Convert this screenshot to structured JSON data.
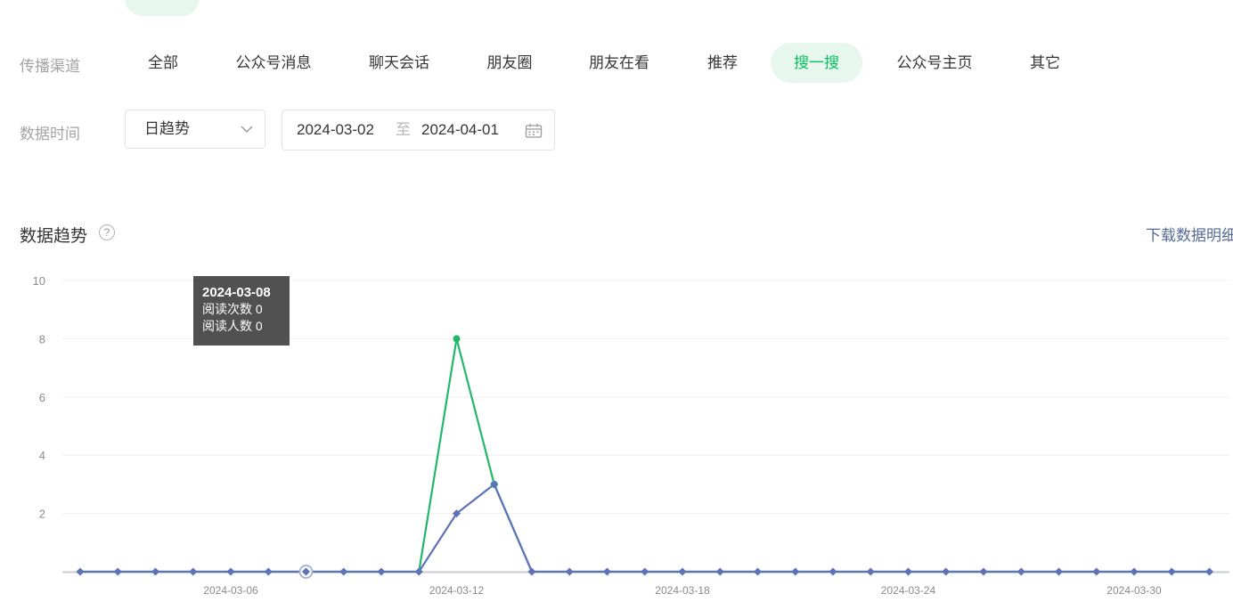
{
  "filters": {
    "channel_label": "传播渠道",
    "channels": [
      "全部",
      "公众号消息",
      "聊天会话",
      "朋友圈",
      "朋友在看",
      "推荐",
      "搜一搜",
      "公众号主页",
      "其它"
    ],
    "active_channel": "搜一搜",
    "time_label": "数据时间",
    "granularity": "日趋势",
    "date_start": "2024-03-02",
    "date_sep": "至",
    "date_end": "2024-04-01"
  },
  "section": {
    "title": "数据趋势",
    "help": "?",
    "download": "下载数据明细"
  },
  "tooltip": {
    "date": "2024-03-08",
    "line1": "阅读次数 0",
    "line2": "阅读人数 0"
  },
  "colors": {
    "accent": "#07c160",
    "series_reads": "#22b76a",
    "series_readers": "#5d72b7"
  },
  "chart_data": {
    "type": "line",
    "x": [
      "2024-03-02",
      "2024-03-03",
      "2024-03-04",
      "2024-03-05",
      "2024-03-06",
      "2024-03-07",
      "2024-03-08",
      "2024-03-09",
      "2024-03-10",
      "2024-03-11",
      "2024-03-12",
      "2024-03-13",
      "2024-03-14",
      "2024-03-15",
      "2024-03-16",
      "2024-03-17",
      "2024-03-18",
      "2024-03-19",
      "2024-03-20",
      "2024-03-21",
      "2024-03-22",
      "2024-03-23",
      "2024-03-24",
      "2024-03-25",
      "2024-03-26",
      "2024-03-27",
      "2024-03-28",
      "2024-03-29",
      "2024-03-30",
      "2024-03-31",
      "2024-04-01"
    ],
    "x_tick_labels": [
      "2024-03-06",
      "2024-03-12",
      "2024-03-18",
      "2024-03-24",
      "2024-03-30"
    ],
    "series": [
      {
        "name": "阅读次数",
        "values": [
          0,
          0,
          0,
          0,
          0,
          0,
          0,
          0,
          0,
          0,
          8,
          3,
          0,
          0,
          0,
          0,
          0,
          0,
          0,
          0,
          0,
          0,
          0,
          0,
          0,
          0,
          0,
          0,
          0,
          0,
          0
        ]
      },
      {
        "name": "阅读人数",
        "values": [
          0,
          0,
          0,
          0,
          0,
          0,
          0,
          0,
          0,
          0,
          2,
          3,
          0,
          0,
          0,
          0,
          0,
          0,
          0,
          0,
          0,
          0,
          0,
          0,
          0,
          0,
          0,
          0,
          0,
          0,
          0
        ]
      }
    ],
    "y_ticks": [
      2,
      4,
      6,
      8,
      10
    ],
    "ylim": [
      0,
      10
    ],
    "highlighted_x": "2024-03-08",
    "grid": true,
    "legend": "none"
  }
}
